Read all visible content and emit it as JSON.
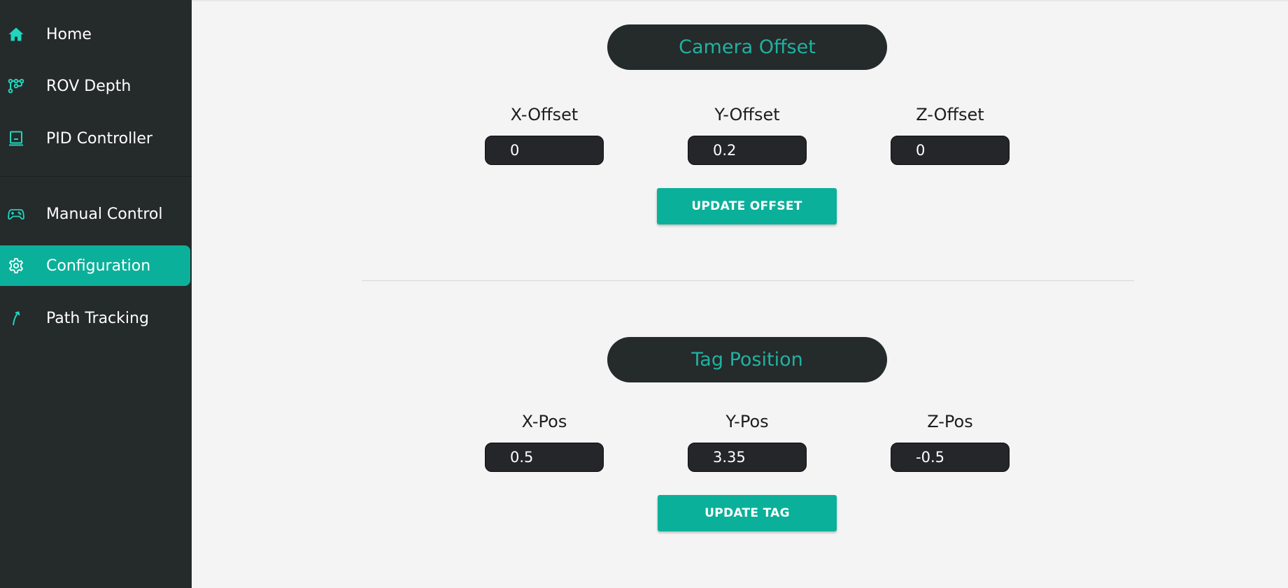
{
  "sidebar": {
    "items": [
      {
        "label": "Home",
        "icon": "home-icon"
      },
      {
        "label": "ROV Depth",
        "icon": "depth-icon"
      },
      {
        "label": "PID Controller",
        "icon": "pid-icon"
      },
      {
        "label": "Manual Control",
        "icon": "gamepad-icon"
      },
      {
        "label": "Configuration",
        "icon": "gear-icon",
        "active": true
      },
      {
        "label": "Path Tracking",
        "icon": "arrow-icon"
      }
    ]
  },
  "camera_offset": {
    "title": "Camera Offset",
    "fields": [
      {
        "label": "X-Offset",
        "value": "0"
      },
      {
        "label": "Y-Offset",
        "value": "0.2"
      },
      {
        "label": "Z-Offset",
        "value": "0"
      }
    ],
    "button": "UPDATE OFFSET"
  },
  "tag_position": {
    "title": "Tag Position",
    "fields": [
      {
        "label": "X-Pos",
        "value": "0.5"
      },
      {
        "label": "Y-Pos",
        "value": "3.35"
      },
      {
        "label": "Z-Pos",
        "value": "-0.5"
      }
    ],
    "button": "UPDATE TAG"
  },
  "colors": {
    "sidebar_bg": "#252a2b",
    "accent": "#0bb09a",
    "accent_text": "#20b2a0",
    "page_bg": "#f4f4f4"
  }
}
